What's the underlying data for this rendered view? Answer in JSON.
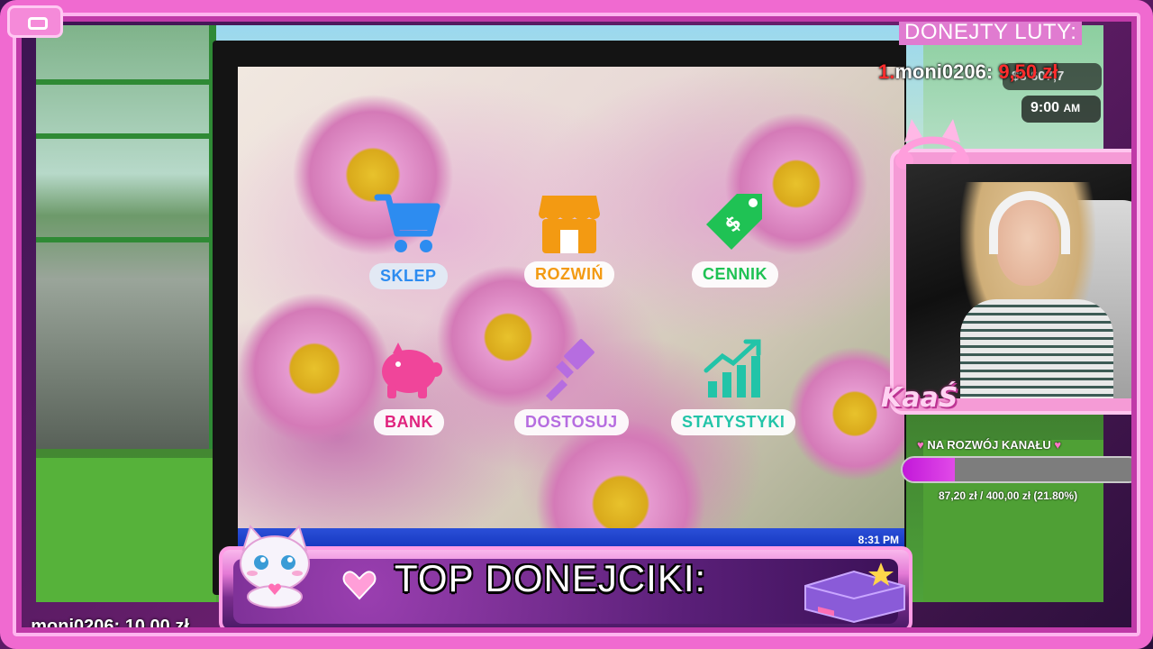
{
  "donations_month": {
    "title": "DONEJTY LUTY:",
    "top": [
      {
        "rank": "1.",
        "name": "moni0206:",
        "amount": "9,50 zł"
      }
    ]
  },
  "game_hud": {
    "money": "$3 607,7",
    "time": "9:00",
    "time_suffix": "AM"
  },
  "desktop": {
    "apps": [
      {
        "label": "SKLEP",
        "icon": "shopping-cart-icon",
        "color": "#2d8cf0"
      },
      {
        "label": "ROZWIŃ",
        "icon": "storefront-icon",
        "color": "#f39a12"
      },
      {
        "label": "CENNIK",
        "icon": "price-tag-icon",
        "color": "#1fc254"
      },
      {
        "label": "BANK",
        "icon": "piggy-bank-icon",
        "color": "#f0459a"
      },
      {
        "label": "DOSTOSUJ",
        "icon": "paint-brush-icon",
        "color": "#b66de0"
      },
      {
        "label": "STATYSTYKI",
        "icon": "growth-chart-icon",
        "color": "#22c4a8"
      }
    ],
    "taskbar_clock": "8:31 PM"
  },
  "streamer": {
    "name": "KaaŚ"
  },
  "goal": {
    "label": "NA ROZWÓJ KANAŁU",
    "progress_text": "87,20 zł / 400,00 zł (21.80%)",
    "progress": 0.218,
    "fill_color": "#c218d9"
  },
  "banner": {
    "title": "TOP DONEJCIKI:"
  },
  "top_donor": {
    "rank": "1.",
    "name_amount": "moni0206: 10,00 zł"
  }
}
